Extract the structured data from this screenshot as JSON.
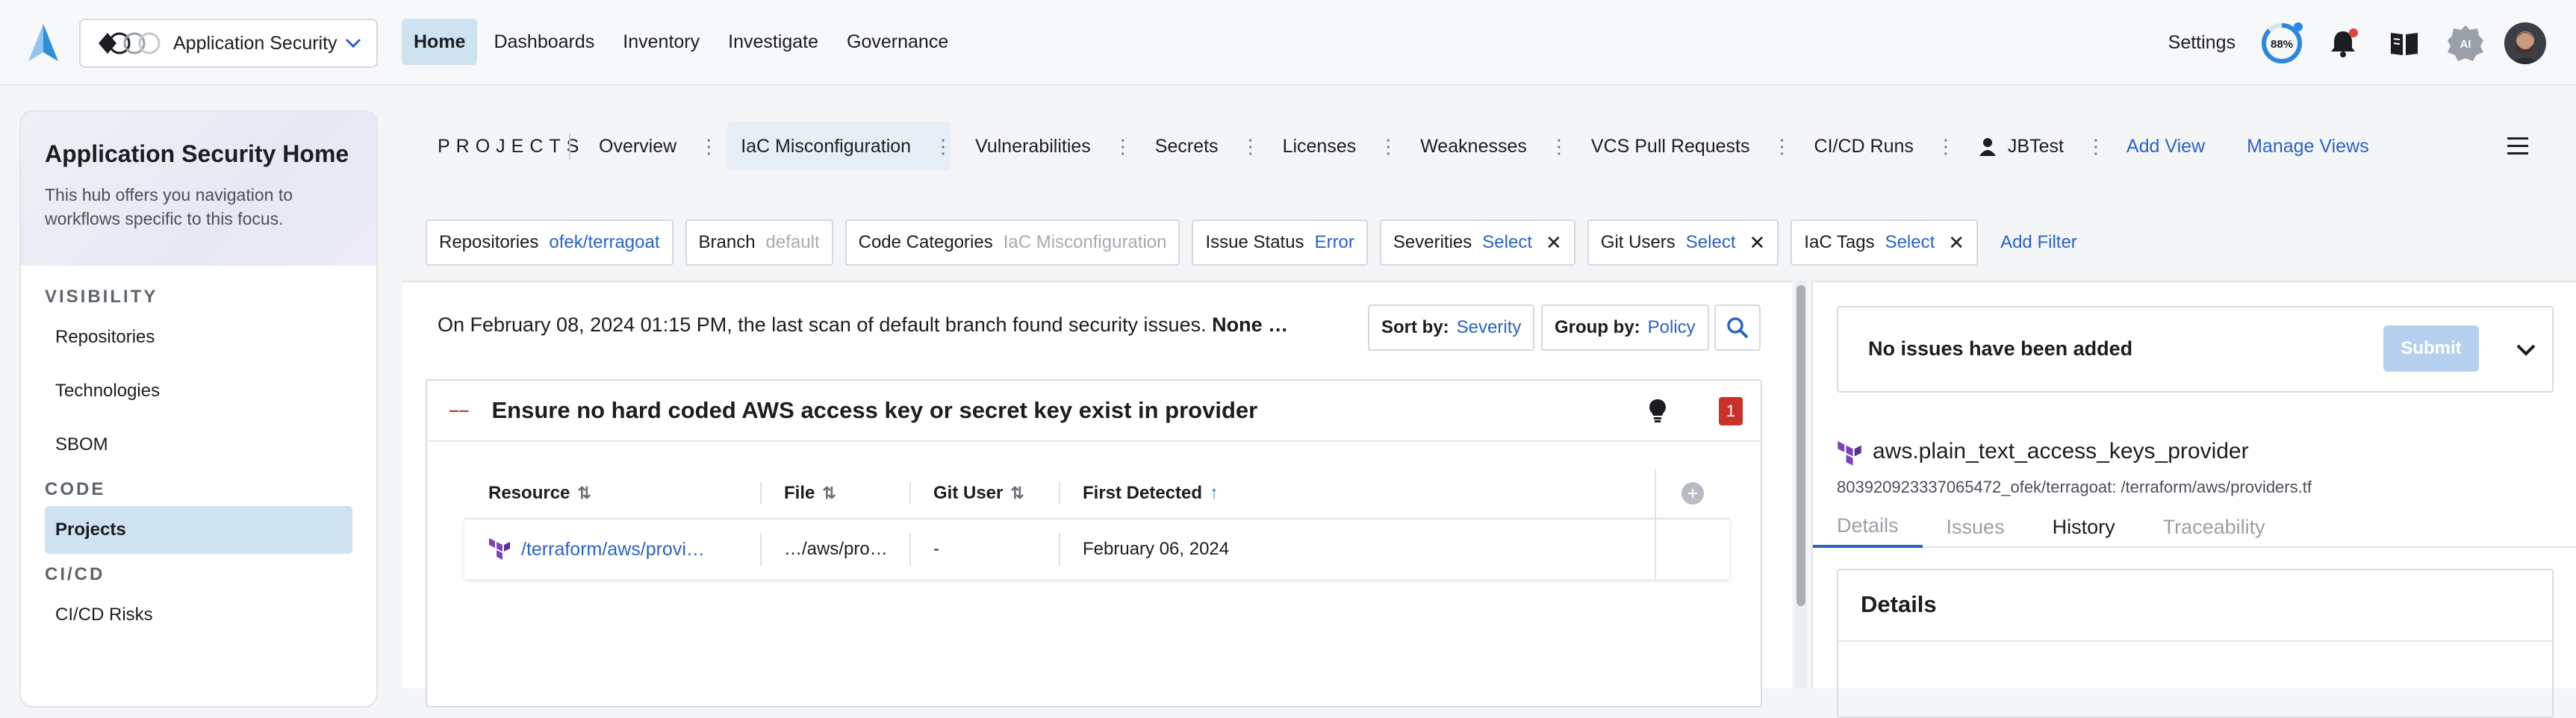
{
  "topbar": {
    "app_name": "Application Security",
    "nav": [
      {
        "label": "Home",
        "active": true
      },
      {
        "label": "Dashboards",
        "active": false
      },
      {
        "label": "Inventory",
        "active": false
      },
      {
        "label": "Investigate",
        "active": false
      },
      {
        "label": "Governance",
        "active": false
      }
    ],
    "settings_label": "Settings",
    "progress_percent": "88%",
    "ai_label": "AI"
  },
  "sidebar": {
    "title": "Application Security Home",
    "description": "This hub offers you navigation to workflows specific to this focus.",
    "sections": [
      {
        "heading": "VISIBILITY",
        "items": [
          "Repositories",
          "Technologies",
          "SBOM"
        ]
      },
      {
        "heading": "CODE",
        "items": [
          "Projects"
        ]
      },
      {
        "heading": "CI/CD",
        "items": [
          "CI/CD Risks"
        ]
      }
    ],
    "active_item": "Projects"
  },
  "project_tabs": {
    "projects_label": "PROJECTS",
    "tabs": [
      {
        "label": "Overview",
        "active": false
      },
      {
        "label": "IaC Misconfiguration",
        "active": true
      },
      {
        "label": "Vulnerabilities",
        "active": false
      },
      {
        "label": "Secrets",
        "active": false
      },
      {
        "label": "Licenses",
        "active": false
      },
      {
        "label": "Weaknesses",
        "active": false
      },
      {
        "label": "VCS Pull Requests",
        "active": false
      },
      {
        "label": "CI/CD Runs",
        "active": false
      },
      {
        "label": "JBTest",
        "active": false
      }
    ],
    "add_view": "Add View",
    "manage_views": "Manage Views"
  },
  "filters": [
    {
      "key": "Repositories",
      "value": "ofek/terragoat",
      "muted": false,
      "removable": false
    },
    {
      "key": "Branch",
      "value": "default",
      "muted": true,
      "removable": false
    },
    {
      "key": "Code Categories",
      "value": "IaC Misconfiguration",
      "muted": true,
      "removable": false
    },
    {
      "key": "Issue Status",
      "value": "Error",
      "muted": false,
      "removable": false
    },
    {
      "key": "Severities",
      "value": "Select",
      "muted": false,
      "removable": true
    },
    {
      "key": "Git Users",
      "value": "Select",
      "muted": false,
      "removable": true
    },
    {
      "key": "IaC Tags",
      "value": "Select",
      "muted": false,
      "removable": true
    }
  ],
  "add_filter": "Add Filter",
  "scan": {
    "message": "On February 08, 2024 01:15 PM, the last scan of default branch found security issues.",
    "suffix": "None …",
    "sort_by_label": "Sort by:",
    "sort_by_value": "Severity",
    "group_by_label": "Group by:",
    "group_by_value": "Policy"
  },
  "policy": {
    "title": "Ensure no hard coded AWS access key or secret key exist in provider",
    "count": "1",
    "columns": [
      "Resource",
      "File",
      "Git User",
      "First Detected"
    ],
    "rows": [
      {
        "resource": "/terraform/aws/provi…",
        "file": "…/aws/pro…",
        "git_user": "-",
        "first_detected": "February 06, 2024"
      }
    ]
  },
  "details": {
    "issues_text": "No issues have been added",
    "submit": "Submit",
    "resource_name": "aws.plain_text_access_keys_provider",
    "resource_path": "803920923337065472_ofek/terragoat: /terraform/aws/providers.tf",
    "tabs": [
      {
        "label": "Details",
        "active": true
      },
      {
        "label": "Issues",
        "active": false
      },
      {
        "label": "History",
        "active": false
      },
      {
        "label": "Traceability",
        "active": false
      }
    ],
    "section_title": "Details"
  },
  "colors": {
    "accent": "#2b63c7",
    "active_bg": "#cfe2f0",
    "severity": "#c8322b",
    "terraform": "#7b42bc"
  }
}
